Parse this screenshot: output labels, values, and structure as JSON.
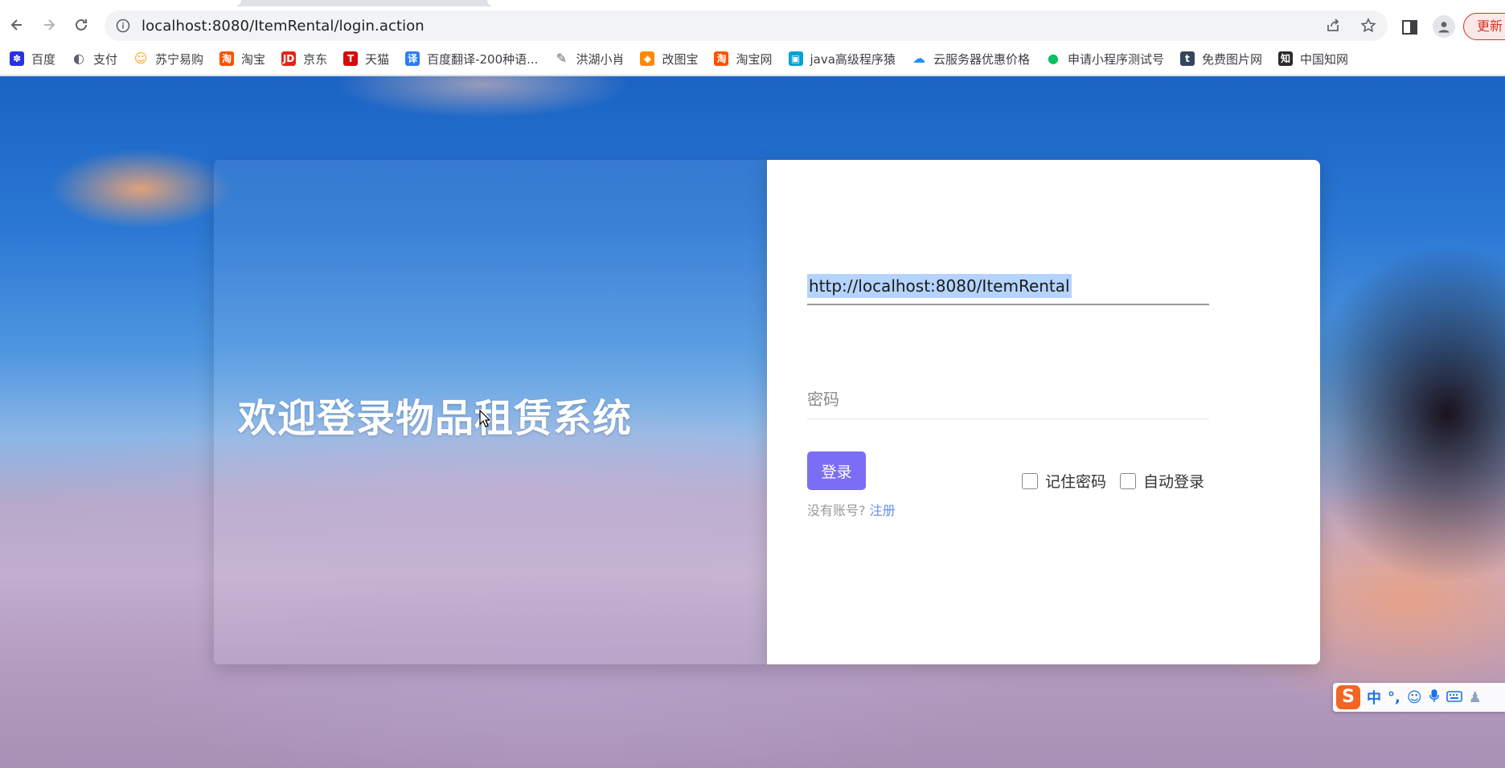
{
  "browser": {
    "url": "localhost:8080/ItemRental/login.action",
    "update_label": "更新",
    "bookmarks": [
      {
        "label": "百度",
        "icon": "baidu-paw-icon",
        "color": "#2932e1"
      },
      {
        "label": "支付",
        "icon": "globe-icon",
        "color": "#5f6368"
      },
      {
        "label": "苏宁易购",
        "icon": "suning-icon",
        "color": "#f5a623"
      },
      {
        "label": "淘宝",
        "icon": "taobao-icon",
        "color": "#ff5000"
      },
      {
        "label": "京东",
        "icon": "jd-icon",
        "color": "#e1251b"
      },
      {
        "label": "天猫",
        "icon": "tmall-icon",
        "color": "#d70b0b"
      },
      {
        "label": "百度翻译-200种语...",
        "icon": "translate-icon",
        "color": "#2d7df6"
      },
      {
        "label": "洪湖小肖",
        "icon": "bird-icon",
        "color": "#5f6368"
      },
      {
        "label": "改图宝",
        "icon": "gaitubao-icon",
        "color": "#ff8a00"
      },
      {
        "label": "淘宝网",
        "icon": "taobao-icon",
        "color": "#ff5000"
      },
      {
        "label": "java高级程序猿",
        "icon": "bilibili-icon",
        "color": "#00a1d6"
      },
      {
        "label": "云服务器优惠价格",
        "icon": "cloud-icon",
        "color": "#1e90ff"
      },
      {
        "label": "申请小程序测试号",
        "icon": "wechat-icon",
        "color": "#07c160"
      },
      {
        "label": "免费图片网",
        "icon": "tumblr-icon",
        "color": "#35465c"
      },
      {
        "label": "中国知网",
        "icon": "cnki-icon",
        "color": "#2b2b2b"
      }
    ]
  },
  "page": {
    "welcome_title": "欢迎登录物品租赁系统",
    "form": {
      "username_value": "http://localhost:8080/ItemRental",
      "password_placeholder": "密码",
      "login_label": "登录",
      "no_account_text": "没有账号?",
      "register_label": "注册",
      "remember_label": "记住密码",
      "autologin_label": "自动登录"
    },
    "accent_color": "#7b6ef6"
  },
  "ime": {
    "logo": "S",
    "mode": "中",
    "punct": "°,"
  }
}
